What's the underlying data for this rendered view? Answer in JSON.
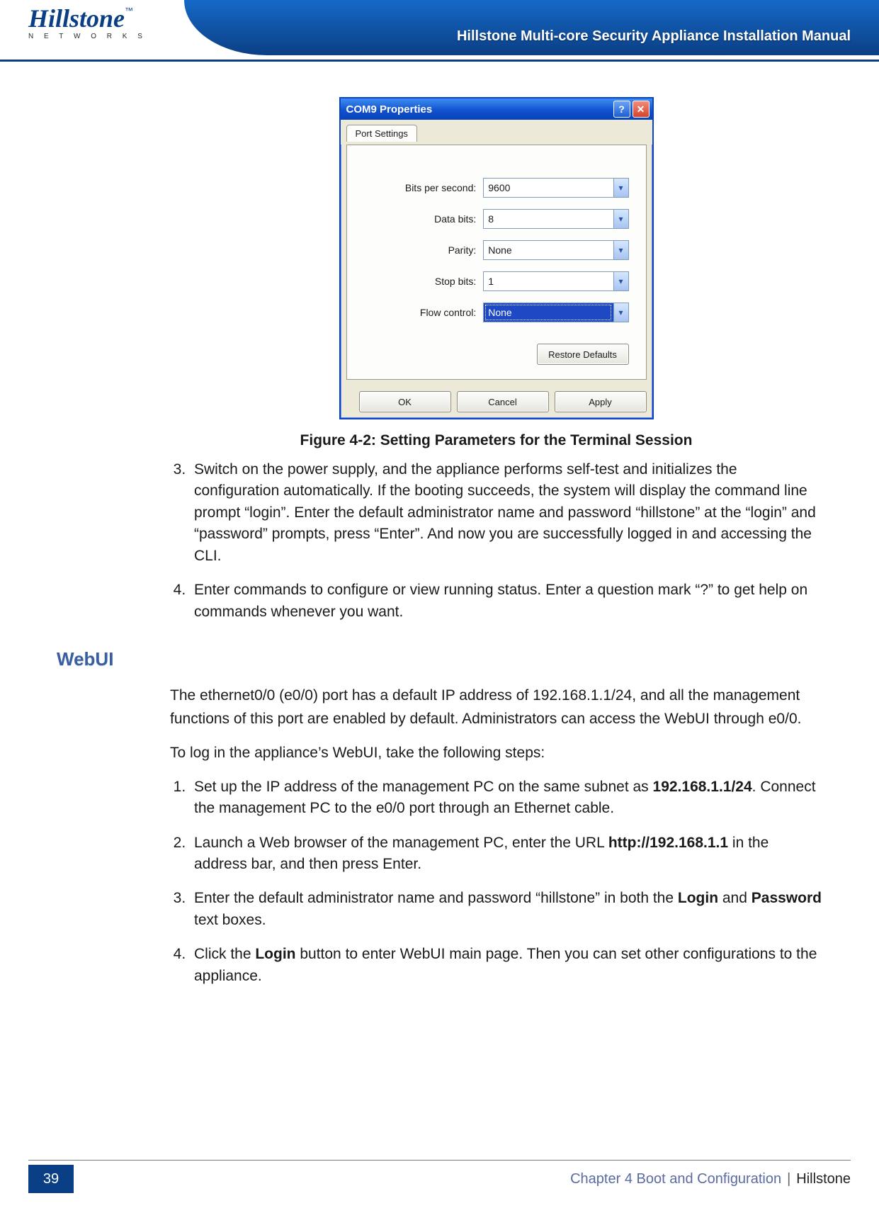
{
  "header": {
    "logo_name": "Hillstone",
    "logo_sub": "N E T W O R K S",
    "logo_tm": "™",
    "title": "Hillstone Multi-core Security Appliance Installation Manual"
  },
  "dialog": {
    "title": "COM9 Properties",
    "help_glyph": "?",
    "close_glyph": "✕",
    "tab_label": "Port Settings",
    "fields": {
      "bits_per_second": {
        "label": "Bits per second:",
        "value": "9600"
      },
      "data_bits": {
        "label": "Data bits:",
        "value": "8"
      },
      "parity": {
        "label": "Parity:",
        "value": "None"
      },
      "stop_bits": {
        "label": "Stop bits:",
        "value": "1"
      },
      "flow_control": {
        "label": "Flow control:",
        "value": "None"
      }
    },
    "restore_label": "Restore Defaults",
    "ok_label": "OK",
    "cancel_label": "Cancel",
    "apply_label": "Apply"
  },
  "figure_caption": "Figure 4-2: Setting Parameters for the Terminal Session",
  "steps_after_figure": [
    "Switch on the power supply, and the appliance performs self-test and initializes the configuration automatically. If the booting succeeds, the system will display the command line prompt “login”. Enter the default administrator name and password “hillstone” at the “login” and “password” prompts, press “Enter”. And now you are successfully logged in and accessing the CLI.",
    "Enter commands to configure or view running status. Enter a question mark “?” to get help on commands whenever you want."
  ],
  "section_heading": "WebUI",
  "webui_intro": "The ethernet0/0 (e0/0) port has a default IP address of 192.168.1.1/24, and all the management functions of this port are enabled by default. Administrators can access the WebUI through e0/0.",
  "webui_lead": "To log in the appliance’s WebUI, take the following steps:",
  "webui_steps": {
    "s1_pre": "Set up the IP address of the management PC on the same subnet as ",
    "s1_b": "192.168.1.1/24",
    "s1_post": ". Connect the management PC to the e0/0 port through an Ethernet cable.",
    "s2_pre": "Launch a Web browser of the management PC, enter the URL ",
    "s2_b": "http://192.168.1.1",
    "s2_post": " in the address bar, and then press Enter.",
    "s3_pre": "Enter the default administrator name and password “hillstone” in both the ",
    "s3_b1": "Login",
    "s3_mid": " and ",
    "s3_b2": "Password",
    "s3_post": " text boxes.",
    "s4_pre": "Click the ",
    "s4_b": "Login",
    "s4_post": " button to enter WebUI main page. Then you can set other configurations to the appliance."
  },
  "footer": {
    "page_number": "39",
    "chapter": "Chapter 4 Boot and Configuration",
    "brand": "Hillstone"
  }
}
